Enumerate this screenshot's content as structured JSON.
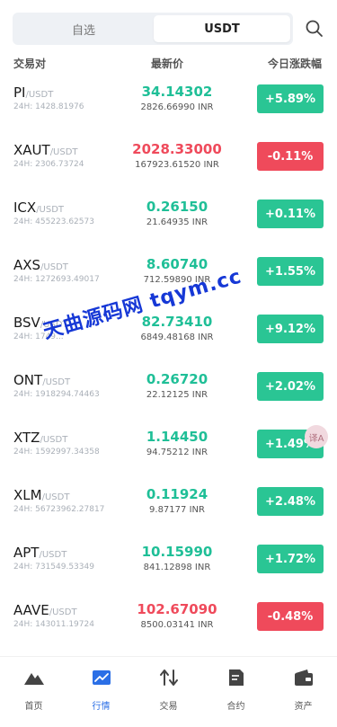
{
  "header": {
    "tabs": [
      {
        "label": "自选",
        "active": false
      },
      {
        "label": "USDT",
        "active": true
      }
    ],
    "search_icon": "search-icon"
  },
  "columns": {
    "pair": "交易对",
    "price": "最新价",
    "change": "今日涨跌幅"
  },
  "colors": {
    "up": "#2ac594",
    "down": "#ef4a5b",
    "active_nav": "#2b6fe6"
  },
  "rows": [
    {
      "base": "PI",
      "quote": "/USDT",
      "volume": "24H: 1428.81976",
      "price": "34.14302",
      "fiat": "2826.66990 INR",
      "change": "+5.89%",
      "dir": "up"
    },
    {
      "base": "XAUT",
      "quote": "/USDT",
      "volume": "24H: 2306.73724",
      "price": "2028.33000",
      "fiat": "167923.61520 INR",
      "change": "-0.11%",
      "dir": "down"
    },
    {
      "base": "ICX",
      "quote": "/USDT",
      "volume": "24H: 455223.62573",
      "price": "0.26150",
      "fiat": "21.64935 INR",
      "change": "+0.11%",
      "dir": "up"
    },
    {
      "base": "AXS",
      "quote": "/USDT",
      "volume": "24H: 1272693.49017",
      "price": "8.60740",
      "fiat": "712.59890 INR",
      "change": "+1.55%",
      "dir": "up"
    },
    {
      "base": "BSV",
      "quote": "/USDT",
      "volume": "24H: 1749...",
      "price": "82.73410",
      "fiat": "6849.48168 INR",
      "change": "+9.12%",
      "dir": "up"
    },
    {
      "base": "ONT",
      "quote": "/USDT",
      "volume": "24H: 1918294.74463",
      "price": "0.26720",
      "fiat": "22.12125 INR",
      "change": "+2.02%",
      "dir": "up"
    },
    {
      "base": "XTZ",
      "quote": "/USDT",
      "volume": "24H: 1592997.34358",
      "price": "1.14450",
      "fiat": "94.75212 INR",
      "change": "+1.49%",
      "dir": "up"
    },
    {
      "base": "XLM",
      "quote": "/USDT",
      "volume": "24H: 56723962.27817",
      "price": "0.11924",
      "fiat": "9.87177 INR",
      "change": "+2.48%",
      "dir": "up"
    },
    {
      "base": "APT",
      "quote": "/USDT",
      "volume": "24H: 731549.53349",
      "price": "10.15990",
      "fiat": "841.12898 INR",
      "change": "+1.72%",
      "dir": "up"
    },
    {
      "base": "AAVE",
      "quote": "/USDT",
      "volume": "24H: 143011.19724",
      "price": "102.67090",
      "fiat": "8500.03141 INR",
      "change": "-0.48%",
      "dir": "down"
    }
  ],
  "watermark": "天曲源码网 tqym.cc",
  "float_button": "译A",
  "nav": [
    {
      "label": "首页",
      "icon": "mountain-icon",
      "active": false
    },
    {
      "label": "行情",
      "icon": "chart-icon",
      "active": true
    },
    {
      "label": "交易",
      "icon": "swap-arrows-icon",
      "active": false
    },
    {
      "label": "合约",
      "icon": "document-icon",
      "active": false
    },
    {
      "label": "资产",
      "icon": "wallet-icon",
      "active": false
    }
  ]
}
